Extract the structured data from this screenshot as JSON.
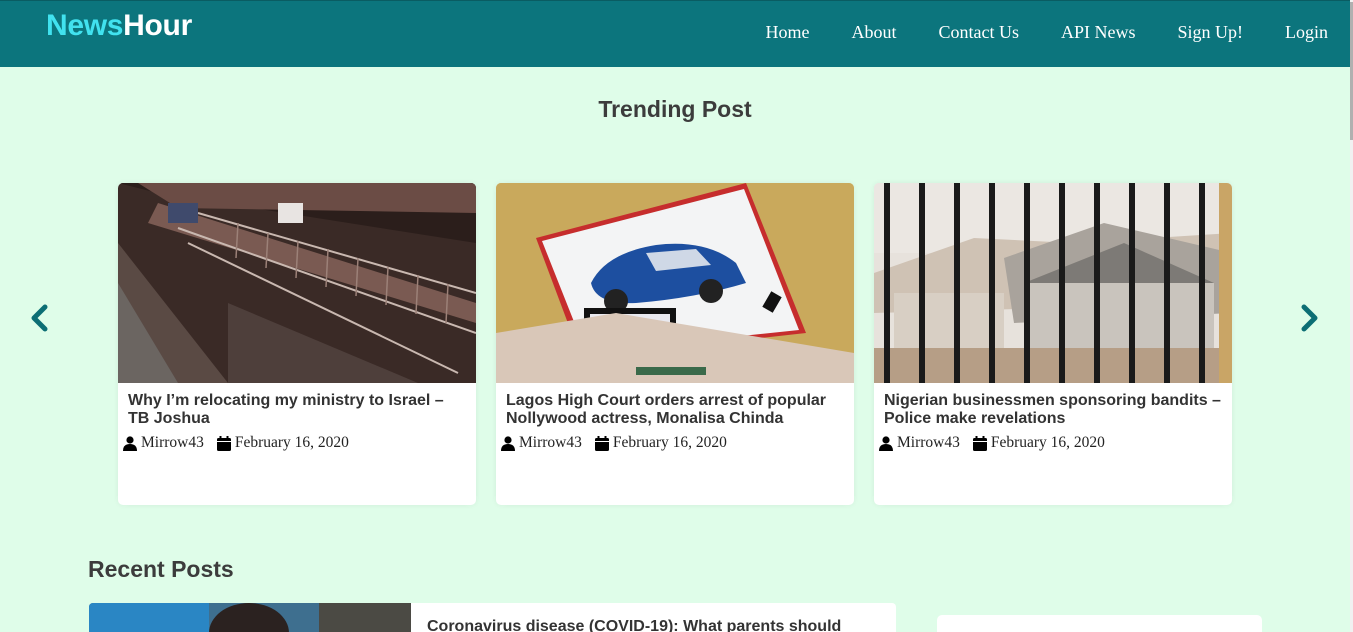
{
  "brand": {
    "part1": "News",
    "part2": "Hour"
  },
  "nav": {
    "items": [
      {
        "label": "Home"
      },
      {
        "label": "About"
      },
      {
        "label": "Contact Us"
      },
      {
        "label": "API News"
      },
      {
        "label": "Sign Up!"
      },
      {
        "label": "Login"
      }
    ]
  },
  "trending": {
    "title": "Trending Post",
    "posts": [
      {
        "title": "Why I’m relocating my ministry to Israel – TB Joshua",
        "author": "Mirrow43",
        "date": "February 16, 2020",
        "image": "stairwell-photo"
      },
      {
        "title": "Lagos High Court orders arrest of popular Nollywood actress, Monalisa Chinda",
        "author": "Mirrow43",
        "date": "February 16, 2020",
        "image": "car-drawing-photo"
      },
      {
        "title": "Nigerian businessmen sponsoring bandits – Police make revelations",
        "author": "Mirrow43",
        "date": "February 16, 2020",
        "image": "fenced-houses-photo"
      }
    ]
  },
  "recent": {
    "title": "Recent Posts",
    "posts": [
      {
        "title": "Coronavirus disease (COVID-19): What parents should"
      }
    ]
  },
  "colors": {
    "navbar": "#0c757d",
    "brand_accent": "#41e2ef",
    "page_bg": "#dffde9",
    "arrow": "#0c6e74"
  },
  "icons": {
    "prev": "chevron-left-icon",
    "next": "chevron-right-icon",
    "author": "user-icon",
    "date": "calendar-icon"
  }
}
